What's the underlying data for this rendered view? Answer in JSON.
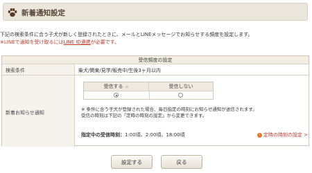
{
  "header": {
    "title": "新着通知設定",
    "icon": "paw-icon"
  },
  "intro": {
    "line1": "下記の検索条件に合う子犬が新しく登録されたときに、メールとLINEメッセージでお知らせする頻度を設定します。",
    "line2_prefix": "※LINEで通知を受け取るには",
    "line2_link": "LINE ID連携",
    "line2_suffix": "が必要です。"
  },
  "table": {
    "caption": "受信頻度の設定",
    "rows": [
      {
        "label": "検索条件",
        "value": "柴犬/関東/見学/販売中/生後3ヶ月以内"
      },
      {
        "label": "新着お知らせ通知"
      }
    ],
    "options": [
      {
        "label": "受信する",
        "selected": true
      },
      {
        "label": "受信しない",
        "selected": false
      }
    ],
    "qmark": "≡",
    "note1": "※ 条件に合う子犬が登録された場合、毎日指定の時刻にお知らせ通知が送信されます。",
    "note2": "受信の時刻は下記の「定時の時刻の設定」から変更できます。",
    "times_label": "指定中の受信時刻：",
    "times_value": "1:00頃、2:00頃、18:00頃",
    "time_link": "定時の時刻の設定 >"
  },
  "buttons": {
    "set": "設定する",
    "back": "戻る"
  }
}
